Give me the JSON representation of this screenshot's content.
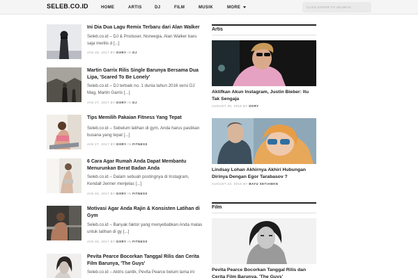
{
  "header": {
    "logo_text": "SELEB",
    "logo_dot": ".",
    "logo_tld": "CO.ID",
    "nav": [
      "HOME",
      "ARTIS",
      "DJ",
      "FILM",
      "MUSIK",
      "MORE"
    ],
    "search_placeholder": "CLICK ENTER TO SEARCH..."
  },
  "articles": [
    {
      "title": "Ini Dia Dua Lagu Remix Terbaru dari Alan Walker",
      "excerpt": "Seleb.co.id – DJ & Produser, Norwegia, Alan Walker baru saja merilis d [...]",
      "date": "JAN 28, 2017",
      "by": "BY",
      "author": "DORY",
      "in": "IN",
      "category": "DJ"
    },
    {
      "title": "Martin Garrix Rilis Single Barunya Bersama Dua Lipa, 'Scared To Be Lonely'",
      "excerpt": "Seleb.co.id – DJ terbaik no. 1 dunia tahun 2016 versi DJ Mag, Martin Garrix [...]",
      "date": "JAN 27, 2017",
      "by": "BY",
      "author": "DORY",
      "in": "IN",
      "category": "DJ"
    },
    {
      "title": "Tips Memilih Pakaian Fitness Yang Tepat",
      "excerpt": "Seleb.co.id – Sebelum latihan di gym, Anda harus pastikan busana yang tepat [...]",
      "date": "JAN 27, 2017",
      "by": "BY",
      "author": "DORY",
      "in": "IN",
      "category": "FITNESS"
    },
    {
      "title": "6 Cara Agar Rumah Anda Dapat Membantu Menurunkan Berat Badan Anda",
      "excerpt": "Seleb.co.id – Dalam sebuah postingnya di Instagram, Kendall Jenner menjelas [...]",
      "date": "JAN 26, 2017",
      "by": "BY",
      "author": "DORY",
      "in": "IN",
      "category": "FITNESS"
    },
    {
      "title": "Motivasi Agar Anda Rajin & Konsisten Latihan di Gym",
      "excerpt": "Seleb.co.id – Banyak faktor yang menyebabkan Anda malas untuk latihan di gy [...]",
      "date": "JAN 26, 2017",
      "by": "BY",
      "author": "DORY",
      "in": "IN",
      "category": "FITNESS"
    },
    {
      "title": "Pevita Pearce Bocorkan Tanggal Rilis dan Cerita Film Barunya, 'The Guys'",
      "excerpt": "Seleb.co.id – Aktris cantik, Pevita Pearce belum lama ini",
      "date": "",
      "by": "",
      "author": "",
      "in": "",
      "category": ""
    }
  ],
  "sidebar": {
    "section_artis": "Artis",
    "artis_posts": [
      {
        "title": "Aktifkan Akun Instagram, Justin Bieber: Itu Tak Sengaja",
        "date": "AUGUST 30, 2016",
        "by": "BY",
        "author": "DORY"
      },
      {
        "title": "Lindsay Lohan Akhirnya Akhiri Hubungan Dirinya Dengan Egor Tarabasov ?",
        "date": "AUGUST 23, 2016",
        "by": "BY",
        "author": "BAYU SETIAWAN"
      }
    ],
    "section_film": "Film",
    "film_posts": [
      {
        "title": "Pevita Pearce Bocorkan Tanggal Rilis dan Cerita Film Barunya, 'The Guys'"
      }
    ]
  },
  "colors": {
    "accent": "#d0021b",
    "nav_bg": "#f5f5f5",
    "text": "#222222"
  }
}
